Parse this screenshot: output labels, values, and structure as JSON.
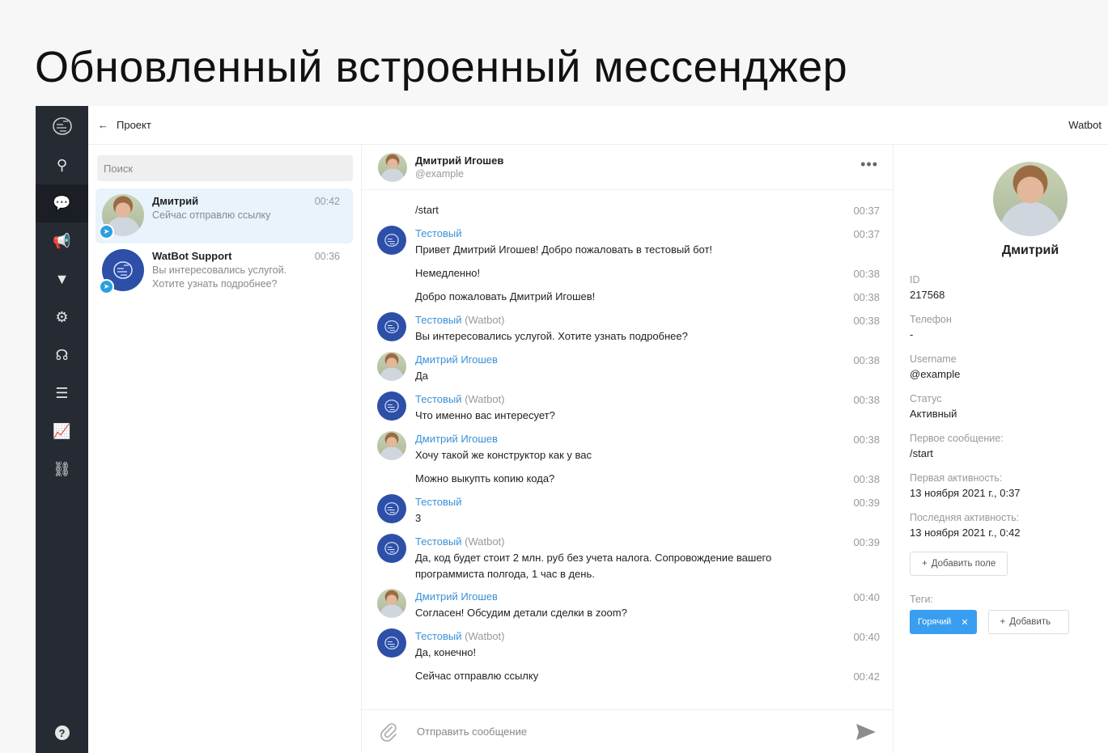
{
  "slide_title": "Обновленный встроенный мессенджер",
  "topbar": {
    "back_label": "Проект",
    "brand": "Watbot"
  },
  "sidebar": {
    "items": [
      {
        "icon": "sitemap-icon",
        "glyph": "⚲"
      },
      {
        "icon": "chat-icon",
        "glyph": "💬"
      },
      {
        "icon": "megaphone-icon",
        "glyph": "📢"
      },
      {
        "icon": "funnel-icon",
        "glyph": "▼"
      },
      {
        "icon": "gear-icon",
        "glyph": "⚙"
      },
      {
        "icon": "support-icon",
        "glyph": "☊"
      },
      {
        "icon": "database-icon",
        "glyph": "☰"
      },
      {
        "icon": "analytics-icon",
        "glyph": "📈"
      },
      {
        "icon": "flow-icon",
        "glyph": "⛓"
      }
    ],
    "active_index": 1,
    "help_glyph": "?"
  },
  "chatlist": {
    "search_placeholder": "Поиск",
    "conversations": [
      {
        "name": "Дмитрий",
        "preview": "Сейчас отправлю ссылку",
        "time": "00:42"
      },
      {
        "name": "WatBot Support",
        "preview": "Вы интересовались услугой. Хотите узнать подробнее?",
        "time": "00:36"
      }
    ]
  },
  "chat": {
    "header": {
      "name": "Дмитрий Игошев",
      "username": "@example",
      "more": "•••"
    },
    "messages": [
      {
        "type": "plain",
        "text": "/start",
        "time": "00:37"
      },
      {
        "type": "bot",
        "sender": "Тестовый",
        "suffix": "",
        "text": "Привет Дмитрий Игошев! Добро пожаловать в тестовый бот!",
        "time": "00:37"
      },
      {
        "type": "plain",
        "text": "Немедленно!",
        "time": "00:38"
      },
      {
        "type": "plain",
        "text": "Добро пожаловать Дмитрий Игошев!",
        "time": "00:38"
      },
      {
        "type": "bot",
        "sender": "Тестовый",
        "suffix": "(Watbot)",
        "text": "Вы интересовались услугой. Хотите узнать подробнее?",
        "time": "00:38"
      },
      {
        "type": "user",
        "sender": "Дмитрий Игошев",
        "suffix": "",
        "text": "Да",
        "time": "00:38"
      },
      {
        "type": "bot",
        "sender": "Тестовый",
        "suffix": "(Watbot)",
        "text": "Что именно вас интересует?",
        "time": "00:38"
      },
      {
        "type": "user",
        "sender": "Дмитрий Игошев",
        "suffix": "",
        "text": "Хочу такой же конструктор как у вас",
        "time": "00:38"
      },
      {
        "type": "plain",
        "text": "Можно выкупть копию кода?",
        "time": "00:38"
      },
      {
        "type": "bot",
        "sender": "Тестовый",
        "suffix": "",
        "text": "3",
        "time": "00:39"
      },
      {
        "type": "bot",
        "sender": "Тестовый",
        "suffix": "(Watbot)",
        "text": "Да, код будет стоит 2 млн. руб без учета налога. Сопровождение вашего программиста полгода, 1 час в день.",
        "time": "00:39"
      },
      {
        "type": "user",
        "sender": "Дмитрий Игошев",
        "suffix": "",
        "text": "Согласен! Обсудим детали сделки в zoom?",
        "time": "00:40"
      },
      {
        "type": "bot",
        "sender": "Тестовый",
        "suffix": "(Watbot)",
        "text": "Да, конечно!",
        "time": "00:40"
      },
      {
        "type": "plain",
        "text": "Сейчас отправлю ссылку",
        "time": "00:42"
      }
    ],
    "composer_placeholder": "Отправить сообщение"
  },
  "details": {
    "name": "Дмитрий",
    "fields": [
      {
        "label": "ID",
        "value": "217568"
      },
      {
        "label": "Телефон",
        "value": "-"
      },
      {
        "label": "Username",
        "value": "@example"
      },
      {
        "label": "Статус",
        "value": "Активный"
      },
      {
        "label": "Первое сообщение:",
        "value": "/start"
      },
      {
        "label": "Первая активность:",
        "value": "13 ноября 2021 г., 0:37"
      },
      {
        "label": "Последняя активность:",
        "value": "13 ноября 2021 г., 0:42"
      }
    ],
    "add_field_label": "Добавить поле",
    "tags_label": "Теги:",
    "tags": [
      "Горячий"
    ],
    "add_tag_label": "Добавить"
  },
  "colors": {
    "accent": "#3a90d6",
    "sidebar": "#262b33",
    "tag": "#3a9ef0",
    "telegram": "#2ba0e0"
  }
}
